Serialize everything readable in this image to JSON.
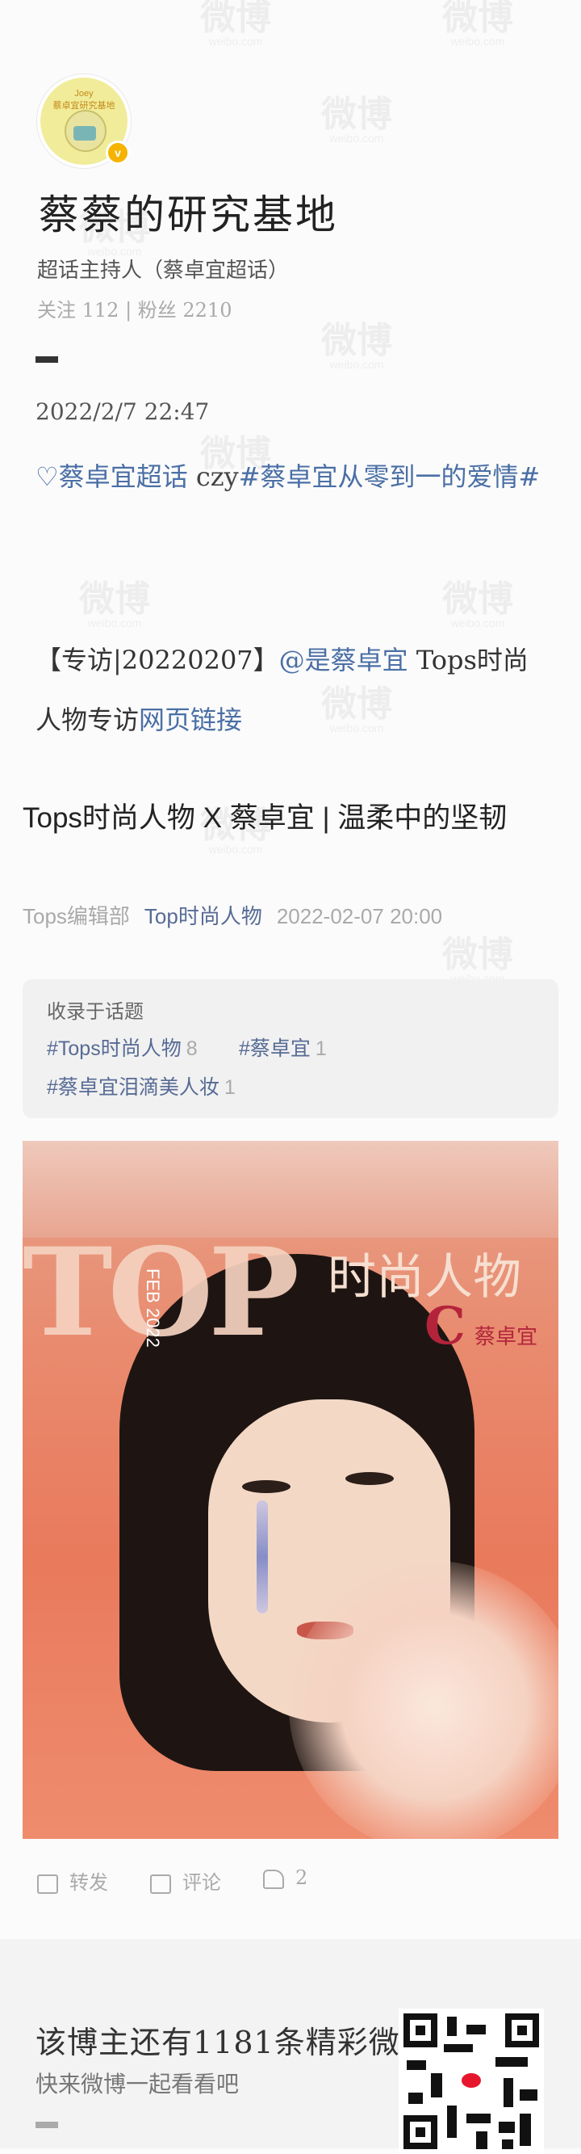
{
  "watermark": {
    "text": "微博",
    "domain": "weibo.com"
  },
  "author": {
    "avatar_label": "Joey",
    "avatar_caption": "蔡卓宜研究基地",
    "verified_mark": "v",
    "name": "蔡蔡的研究基地",
    "role": "超话主持人（蔡卓宜超话）",
    "stats": "关注 112 | 粉丝 2210"
  },
  "post": {
    "time": "2022/2/7 22:47",
    "topic_icon": "♡",
    "topic_super": "蔡卓宜超话",
    "topic_sep": " czy",
    "topic_hashtag": "#蔡卓宜从零到一的爱情#",
    "interview_prefix": "【专访|20220207】",
    "interview_mention": "@是蔡卓宜",
    "interview_text": " Tops时尚人物专访",
    "interview_link": "网页链接"
  },
  "article": {
    "title": "Tops时尚人物 X 蔡卓宜 | 温柔中的坚韧",
    "source": "Tops编辑部",
    "account": "Top时尚人物",
    "date": "2022-02-07 20:00",
    "topics_heading": "收录于话题",
    "topics": [
      {
        "name": "#Tops时尚人物",
        "count": "8"
      },
      {
        "name": "#蔡卓宜",
        "count": "1"
      },
      {
        "name": "#蔡卓宜泪滴美人妆",
        "count": "1"
      }
    ],
    "cover": {
      "masthead": "TOP",
      "issue": "FEB 2022",
      "title": "时尚人物",
      "letter": "C",
      "name": "蔡卓宜"
    }
  },
  "actions": {
    "repost": "转发",
    "comment": "评论",
    "like_count": "2"
  },
  "footer": {
    "main": "该博主还有1181条精彩微博",
    "sub": "快来微博一起看看吧"
  }
}
